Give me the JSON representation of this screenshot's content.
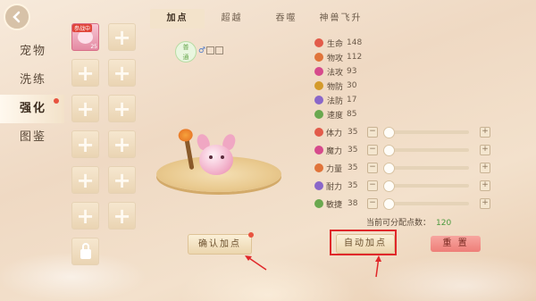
{
  "nav": {
    "items": [
      {
        "label": "宠物",
        "active": false
      },
      {
        "label": "洗练",
        "active": false
      },
      {
        "label": "强化",
        "active": true
      },
      {
        "label": "图鉴",
        "active": false
      }
    ]
  },
  "pet_slot": {
    "badge": "参战中",
    "level": "25"
  },
  "tabs": [
    {
      "label": "加点",
      "active": true
    },
    {
      "label": "超越",
      "active": false
    },
    {
      "label": "吞噬",
      "active": false
    },
    {
      "label": "神兽飞升",
      "active": false
    }
  ],
  "pet": {
    "tier_line1": "普",
    "tier_line2": "通"
  },
  "stats": [
    {
      "label": "生命",
      "value": "148",
      "color": "#e25b4a",
      "icon": "heart-icon"
    },
    {
      "label": "物攻",
      "value": "112",
      "color": "#e0743a",
      "icon": "sword-icon"
    },
    {
      "label": "法攻",
      "value": "93",
      "color": "#d64a8c",
      "icon": "magic-icon"
    },
    {
      "label": "物防",
      "value": "30",
      "color": "#d49a2b",
      "icon": "shield-icon"
    },
    {
      "label": "法防",
      "value": "17",
      "color": "#8a67c9",
      "icon": "magic-shield-icon"
    },
    {
      "label": "速度",
      "value": "85",
      "color": "#6aa84f",
      "icon": "speed-icon"
    }
  ],
  "allocation": [
    {
      "label": "体力",
      "value": "35",
      "color": "#e25b4a",
      "icon": "stamina-icon",
      "level": 0.05
    },
    {
      "label": "魔力",
      "value": "35",
      "color": "#d64a8c",
      "icon": "mana-icon",
      "level": 0.05
    },
    {
      "label": "力量",
      "value": "35",
      "color": "#e0743a",
      "icon": "strength-icon",
      "level": 0.05
    },
    {
      "label": "耐力",
      "value": "35",
      "color": "#8a67c9",
      "icon": "endurance-icon",
      "level": 0.05
    },
    {
      "label": "敏捷",
      "value": "38",
      "color": "#6aa84f",
      "icon": "agility-icon",
      "level": 0.05
    }
  ],
  "remaining": {
    "label": "当前可分配点数：",
    "value": "120"
  },
  "buttons": {
    "confirm": "确认加点",
    "auto": "自动加点",
    "reset": "重 置"
  },
  "colors": {
    "highlight": "#e0282a",
    "active_nav_dot": "#e8533f"
  }
}
